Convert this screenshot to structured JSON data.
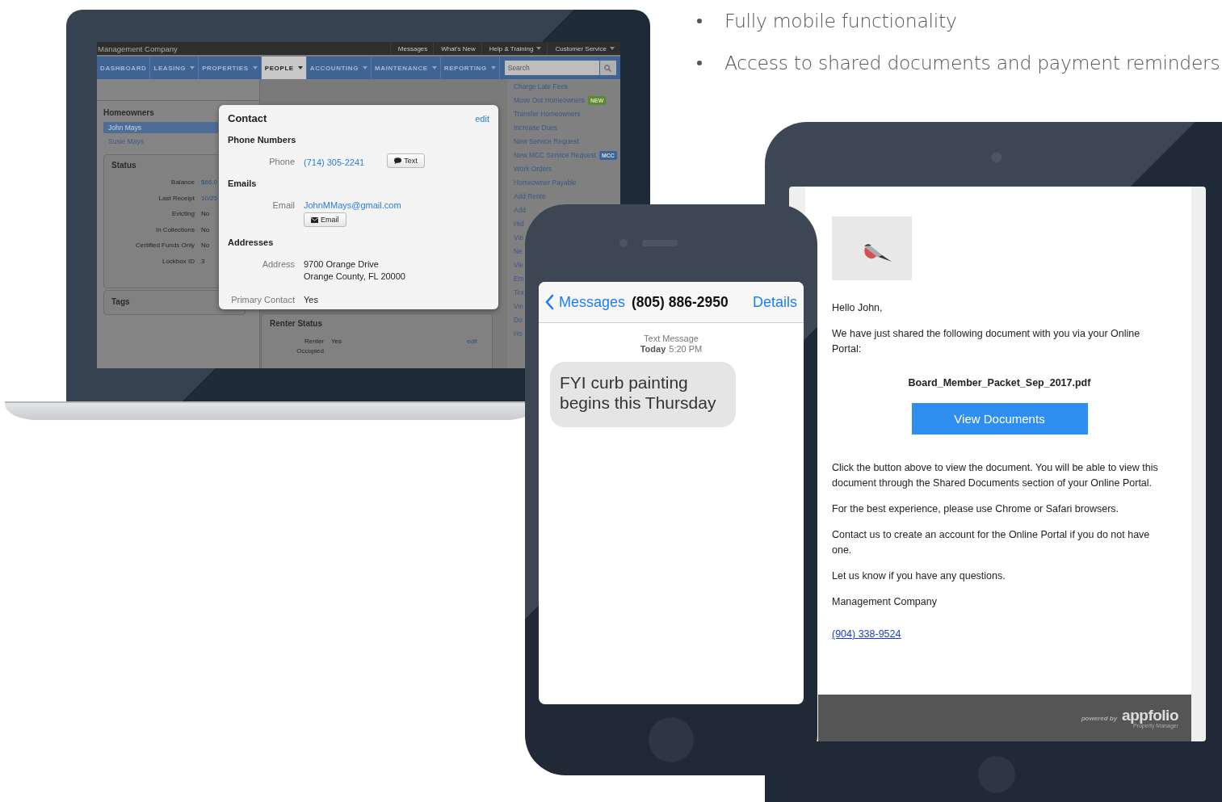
{
  "bullets": [
    "Fully mobile functionality",
    "Access to shared documents and payment reminders"
  ],
  "laptop": {
    "company": "Management Company",
    "top_links": [
      {
        "label": "Messages",
        "caret": false
      },
      {
        "label": "What's New",
        "caret": false
      },
      {
        "label": "Help & Training",
        "caret": true
      },
      {
        "label": "Customer Service",
        "caret": true
      }
    ],
    "nav_tabs": [
      {
        "label": "DASHBOARD",
        "caret": false,
        "selected": false
      },
      {
        "label": "LEASING",
        "caret": true,
        "selected": false
      },
      {
        "label": "PROPERTIES",
        "caret": true,
        "selected": false
      },
      {
        "label": "PEOPLE",
        "caret": true,
        "selected": true
      },
      {
        "label": "ACCOUNTING",
        "caret": true,
        "selected": false
      },
      {
        "label": "MAINTENANCE",
        "caret": true,
        "selected": false
      },
      {
        "label": "REPORTING",
        "caret": true,
        "selected": false
      }
    ],
    "search": {
      "placeholder": "Search"
    },
    "homeowners": {
      "title": "Homeowners",
      "items": [
        {
          "label": "John Mays",
          "selected": true
        },
        {
          "label": "Susie Mays",
          "selected": false
        }
      ]
    },
    "status": {
      "title": "Status",
      "rows": [
        {
          "label": "Balance",
          "value": "$66.0",
          "kind": "link"
        },
        {
          "label": "Last Receipt",
          "value": "10/25",
          "kind": "link"
        },
        {
          "label": "Evicting",
          "value": "No",
          "kind": "text"
        },
        {
          "label": "In Collections",
          "value": "No",
          "kind": "text"
        },
        {
          "label": "Certified Funds Only",
          "value": "No",
          "kind": "text"
        },
        {
          "label": "Lockbox ID",
          "value": "3",
          "kind": "text"
        }
      ]
    },
    "tags": {
      "title": "Tags"
    },
    "renter_status": {
      "title": "Renter Status",
      "label_lines": [
        "Renter",
        "Occupied"
      ],
      "value": "Yes",
      "edit": "edit"
    },
    "actions": [
      {
        "label": "Charge Late Fees"
      },
      {
        "label": "Move Out Homeowners",
        "badge": {
          "text": "NEW",
          "color": "#5e8a2f"
        }
      },
      {
        "label": "Transfer Homeowners"
      },
      {
        "label": "Increase Dues"
      },
      {
        "label": "New Service Request"
      },
      {
        "label": "New MCC Service Request",
        "badge": {
          "text": "MCC",
          "color": "#3d64a0"
        }
      },
      {
        "label": "Work Orders"
      },
      {
        "label": "Homeowner Payable"
      },
      {
        "label": "Add Rente"
      },
      {
        "label": "Add"
      },
      {
        "label": "Hid"
      },
      {
        "label": "Vie"
      },
      {
        "label": "Ne"
      },
      {
        "label": "Vie"
      },
      {
        "label": "Em"
      },
      {
        "label": "Tex"
      },
      {
        "label": "Vie"
      },
      {
        "label": "Do"
      },
      {
        "label": "Ho"
      }
    ],
    "contact": {
      "title": "Contact",
      "edit": "edit",
      "sections": [
        {
          "heading": "Phone Numbers",
          "rows": [
            {
              "label": "Phone",
              "lines": [
                "(714) 305-2241"
              ],
              "kind": "link",
              "button": {
                "label": "Text",
                "kind": "message"
              }
            }
          ]
        },
        {
          "heading": "Emails",
          "rows": [
            {
              "label": "Email",
              "lines": [
                "JohnMMays@gmail.com"
              ],
              "kind": "link",
              "button": {
                "label": "Email",
                "kind": "email"
              }
            }
          ]
        },
        {
          "heading": "Addresses",
          "rows": [
            {
              "label": "Address",
              "lines": [
                "9700 Orange Drive",
                "Orange County, FL 20000"
              ],
              "kind": "text"
            }
          ]
        },
        {
          "rows": [
            {
              "label": "Primary Contact",
              "lines": [
                "Yes"
              ],
              "kind": "text"
            }
          ]
        }
      ]
    }
  },
  "phone": {
    "back": "Messages",
    "title": "(805) 886-2950",
    "action": "Details",
    "meta_label": "Text Message",
    "meta_day": "Today",
    "meta_time": "5:20 PM",
    "bubble": "FYI curb painting begins this Thursday"
  },
  "tablet": {
    "blocks": [
      {
        "kind": "text",
        "text": "Hello John,"
      },
      {
        "kind": "text",
        "text": "We have just shared the following document with you via your Online Portal:"
      },
      {
        "kind": "file",
        "text": "Board_Member_Packet_Sep_2017.pdf"
      },
      {
        "kind": "button",
        "text": "View Documents"
      },
      {
        "kind": "text",
        "text": "Click the button above to view the document. You will be able to view this document through the Shared Documents section of your Online Portal."
      },
      {
        "kind": "text",
        "text": "For the best experience, please use Chrome or Safari browsers."
      },
      {
        "kind": "text",
        "text": "Contact us to create an account for the Online Portal if you do not have one."
      },
      {
        "kind": "text",
        "text": "Let us know if you have any questions."
      },
      {
        "kind": "text",
        "text": "Management Company"
      },
      {
        "kind": "link",
        "text": "(904) 338-9524"
      }
    ],
    "footer": {
      "powered": "powered by",
      "brand": "appfolio",
      "sub": "Property Manager"
    }
  }
}
